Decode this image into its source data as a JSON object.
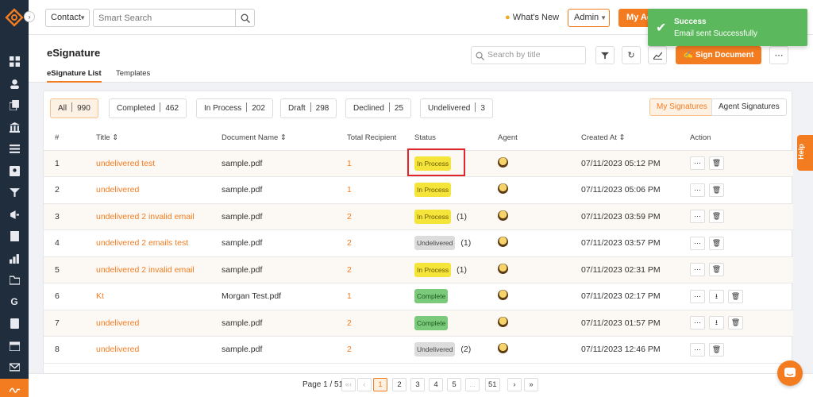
{
  "topbar": {
    "contact_select": "Contact",
    "search_placeholder": "Smart Search",
    "whats_new": "What's New",
    "admin_select": "Admin",
    "my_agent_button": "My Ag"
  },
  "toast": {
    "title": "Success",
    "message": "Email sent Successfully"
  },
  "page": {
    "title": "eSignature",
    "tabs": [
      "eSignature List",
      "Templates"
    ],
    "search_placeholder": "Search by title",
    "sign_document_button": "Sign Document"
  },
  "filters": [
    {
      "label": "All",
      "count": "990"
    },
    {
      "label": "Completed",
      "count": "462"
    },
    {
      "label": "In Process",
      "count": "202"
    },
    {
      "label": "Draft",
      "count": "298"
    },
    {
      "label": "Declined",
      "count": "25"
    },
    {
      "label": "Undelivered",
      "count": "3"
    }
  ],
  "views": [
    "My Signatures",
    "Agent Signatures"
  ],
  "table": {
    "headers": [
      "#",
      "Title",
      "Document Name",
      "Total Recipient",
      "Status",
      "Agent",
      "Created At",
      "Action"
    ],
    "rows": [
      {
        "idx": "1",
        "title": "undelivered test",
        "doc": "sample.pdf",
        "recipients": "1",
        "status": "In Process",
        "status_count": "",
        "created": "07/11/2023 05:12 PM"
      },
      {
        "idx": "2",
        "title": "undelivered",
        "doc": "sample.pdf",
        "recipients": "1",
        "status": "In Process",
        "status_count": "",
        "created": "07/11/2023 05:06 PM"
      },
      {
        "idx": "3",
        "title": "undelivered 2 invalid email",
        "doc": "sample.pdf",
        "recipients": "2",
        "status": "In Process",
        "status_count": "(1)",
        "created": "07/11/2023 03:59 PM"
      },
      {
        "idx": "4",
        "title": "undelivered 2 emails test",
        "doc": "sample.pdf",
        "recipients": "2",
        "status": "Undelivered",
        "status_count": "(1)",
        "created": "07/11/2023 03:57 PM"
      },
      {
        "idx": "5",
        "title": "undelivered 2 invalid email",
        "doc": "sample.pdf",
        "recipients": "2",
        "status": "In Process",
        "status_count": "(1)",
        "created": "07/11/2023 02:31 PM"
      },
      {
        "idx": "6",
        "title": "Kt",
        "doc": "Morgan Test.pdf",
        "recipients": "1",
        "status": "Complete",
        "status_count": "",
        "created": "07/11/2023 02:17 PM"
      },
      {
        "idx": "7",
        "title": "undelivered",
        "doc": "sample.pdf",
        "recipients": "2",
        "status": "Complete",
        "status_count": "",
        "created": "07/11/2023 01:57 PM"
      },
      {
        "idx": "8",
        "title": "undelivered",
        "doc": "sample.pdf",
        "recipients": "2",
        "status": "Undelivered",
        "status_count": "(2)",
        "created": "07/11/2023 12:46 PM"
      }
    ]
  },
  "pagination": {
    "info": "Page 1 / 51",
    "pages": [
      "1",
      "2",
      "3",
      "4",
      "5",
      "...",
      "51"
    ]
  },
  "help_label": "Help",
  "colors": {
    "accent": "#f47c20",
    "sidebar": "#1f2d3d",
    "toast": "#5cb85c"
  }
}
